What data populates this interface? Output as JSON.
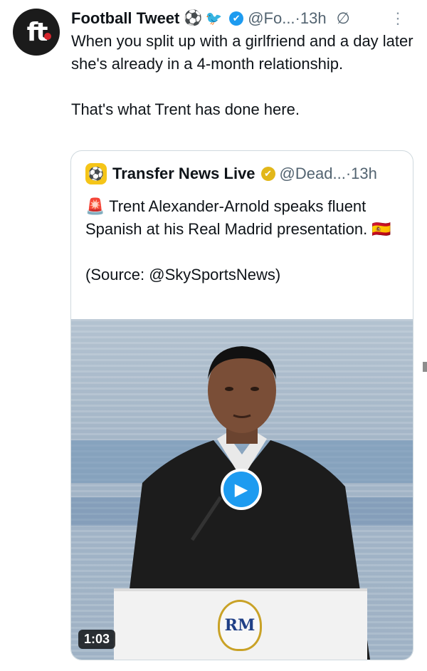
{
  "tweet": {
    "author_name": "Football Tweet",
    "author_handle": "@Fo...",
    "time_sep": " · ",
    "time": "13h",
    "ball_icon": "⚽",
    "bird_icon": "🐦",
    "text": "When you split up with a girlfriend and a day later she's already in a 4-month relationship.\n\nThat's what Trent has done here.",
    "avatar_text": "ft"
  },
  "quote": {
    "author_name": "Transfer News Live",
    "author_handle": "@Dead...",
    "time_sep": " · ",
    "time": "13h",
    "avatar_icon": "⚽",
    "text": "🚨 Trent Alexander-Arnold speaks fluent Spanish at his Real Madrid presentation. 🇪🇸\n\n(Source: @SkySportsNews)",
    "video_duration": "1:03"
  },
  "colors": {
    "accent_blue": "#1d9bf0",
    "gold_badge": "#e2b719",
    "muted_text": "#536471"
  },
  "icons": {
    "verified": "✔",
    "grok": "∅",
    "more": "⋮",
    "play": "▶"
  }
}
